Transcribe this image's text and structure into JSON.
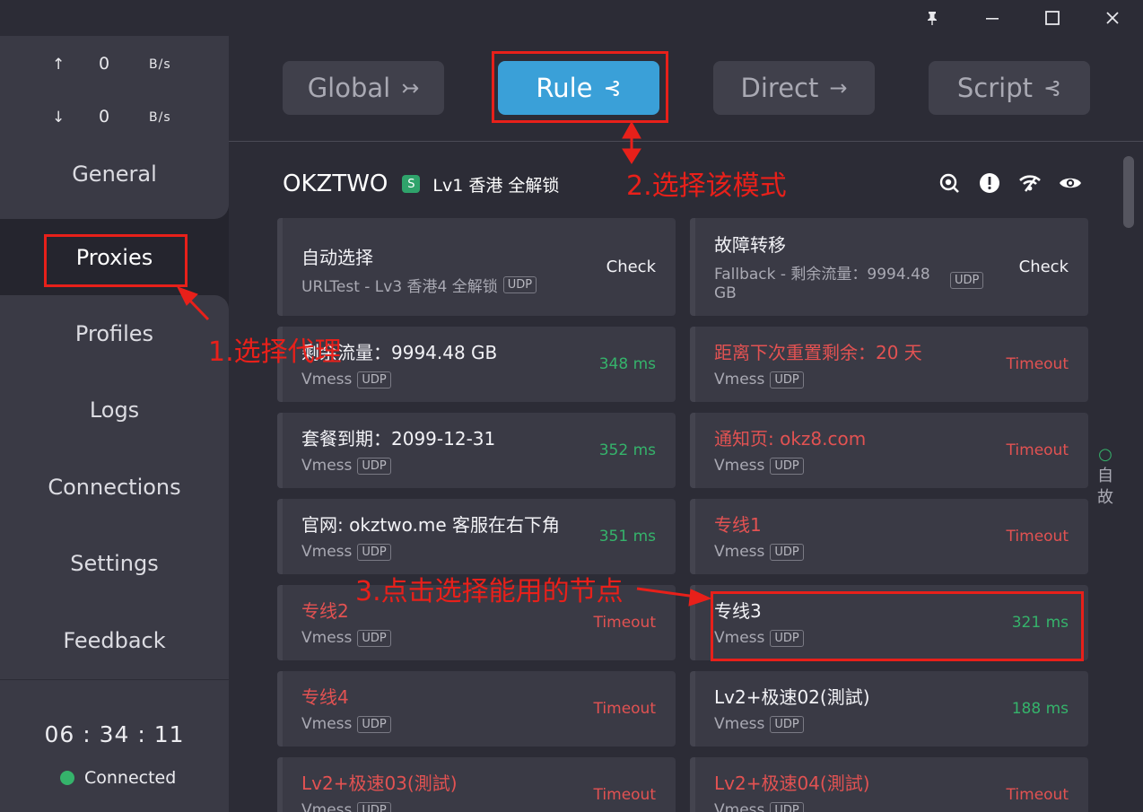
{
  "window": {
    "buttons": [
      "pin-icon",
      "minimize-icon",
      "maximize-icon",
      "close-icon"
    ]
  },
  "sidebar": {
    "traffic": {
      "up_arrow": "↑",
      "up_value": "0",
      "up_unit": "B/s",
      "down_arrow": "↓",
      "down_value": "0",
      "down_unit": "B/s"
    },
    "nav": {
      "general": "General",
      "proxies": "Proxies",
      "profiles": "Profiles",
      "logs": "Logs",
      "connections": "Connections",
      "settings": "Settings",
      "feedback": "Feedback"
    },
    "active_item": "Proxies",
    "clock": "06 : 34 : 11",
    "status": "Connected",
    "status_color": "#35b36b"
  },
  "modes": {
    "global": "Global",
    "rule": "Rule",
    "direct": "Direct",
    "script": "Script",
    "active": "Rule",
    "accent": "#3aa0d8"
  },
  "group": {
    "name": "OKZTWO",
    "badge": "S",
    "selected": "Lv1 香港 全解锁",
    "icons": [
      "search-icon",
      "alert-icon",
      "wifi-icon",
      "eye-icon"
    ]
  },
  "proxies": {
    "r0": {
      "left": {
        "name": "自动选择",
        "sub": "URLTest - Lv3 香港4 全解锁",
        "udp": "UDP",
        "delay": "Check"
      },
      "right": {
        "name": "故障转移",
        "sub1": "Fallback - 剩余流量：9994.48",
        "sub2": "GB",
        "udp": "UDP",
        "delay": "Check"
      }
    },
    "r1": {
      "left": {
        "name": "剩余流量：9994.48 GB",
        "type": "Vmess",
        "udp": "UDP",
        "delay": "348 ms"
      },
      "right": {
        "name": "距离下次重置剩余：20 天",
        "type": "Vmess",
        "udp": "UDP",
        "delay": "Timeout"
      }
    },
    "r2": {
      "left": {
        "name": "套餐到期：2099-12-31",
        "type": "Vmess",
        "udp": "UDP",
        "delay": "352 ms"
      },
      "right": {
        "name": "通知页: okz8.com",
        "type": "Vmess",
        "udp": "UDP",
        "delay": "Timeout"
      }
    },
    "r3": {
      "left": {
        "name": "官网: okztwo.me 客服在右下角",
        "type": "Vmess",
        "udp": "UDP",
        "delay": "351 ms"
      },
      "right": {
        "name": "专线1",
        "type": "Vmess",
        "udp": "UDP",
        "delay": "Timeout"
      }
    },
    "r4": {
      "left": {
        "name": "专线2",
        "type": "Vmess",
        "udp": "UDP",
        "delay": "Timeout"
      },
      "right": {
        "name": "专线3",
        "type": "Vmess",
        "udp": "UDP",
        "delay": "321 ms"
      }
    },
    "r5": {
      "left": {
        "name": "专线4",
        "type": "Vmess",
        "udp": "UDP",
        "delay": "Timeout"
      },
      "right": {
        "name": "Lv2+极速02(測試)",
        "type": "Vmess",
        "udp": "UDP",
        "delay": "188 ms"
      }
    },
    "r6": {
      "left": {
        "name": "Lv2+极速03(測試)",
        "type": "Vmess",
        "udp": "UDP",
        "delay": "Timeout"
      },
      "right": {
        "name": "Lv2+极速04(測試)",
        "type": "Vmess",
        "udp": "UDP",
        "delay": "Timeout"
      }
    }
  },
  "side_labels": {
    "circle": "○",
    "a": "自",
    "b": "故"
  },
  "annotations": {
    "step1": "1.选择代理",
    "step2": "2.选择该模式",
    "step3": "3.点击选择能用的节点",
    "color": "#e8201a"
  }
}
